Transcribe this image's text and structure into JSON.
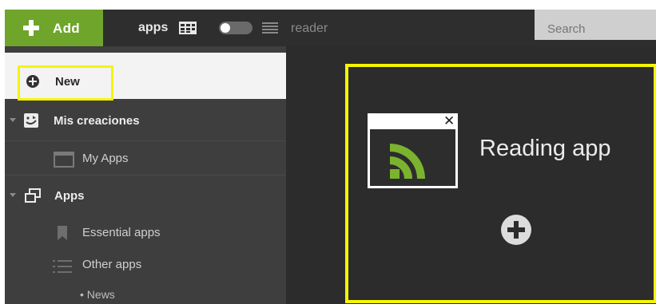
{
  "toolbar": {
    "add_label": "Add",
    "view_apps_label": "apps",
    "view_reader_label": "reader",
    "search_placeholder": "Search"
  },
  "sidebar": {
    "new_label": "New",
    "mis_creaciones_label": "Mis creaciones",
    "my_apps_label": "My Apps",
    "apps_label": "Apps",
    "essential_apps_label": "Essential apps",
    "other_apps_label": "Other apps",
    "news_label": "• News"
  },
  "main": {
    "card_title": "Reading app",
    "close_glyph": "✕"
  },
  "colors": {
    "accent_green": "#6fa52b",
    "highlight_yellow": "#f5f500",
    "topbar_bg": "#2e2e2e",
    "sidebar_bg": "#3e3e3e",
    "content_bg": "#2c2c2c"
  },
  "icons": [
    "plus-icon",
    "grid-view-icon",
    "toggle-switch",
    "list-view-icon",
    "new-circle-icon",
    "creaciones-icon",
    "window-icon",
    "apps-icon",
    "bookmark-icon",
    "list-icon",
    "rss-icon",
    "close-icon",
    "add-circle-icon"
  ]
}
